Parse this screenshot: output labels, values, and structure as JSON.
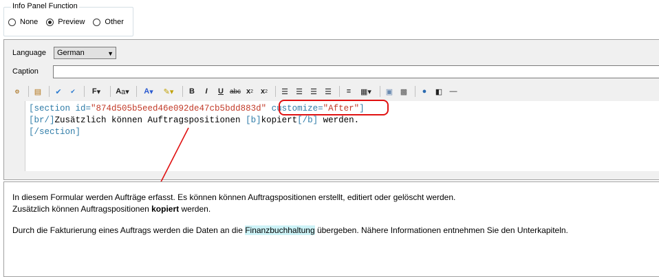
{
  "info_panel": {
    "title": "Info Panel Function",
    "options": [
      {
        "label": "None",
        "selected": false
      },
      {
        "label": "Preview",
        "selected": true
      },
      {
        "label": "Other",
        "selected": false
      }
    ]
  },
  "form": {
    "language_label": "Language",
    "language_value": "German",
    "caption_label": "Caption",
    "caption_value": ""
  },
  "toolbar": {
    "icons": [
      "section-icon",
      "document-icon",
      "spellcheck-icon",
      "spellcheck-all-icon",
      "font-icon",
      "font-size-icon",
      "font-color-icon",
      "highlight-color-icon",
      "bold-icon",
      "italic-icon",
      "underline-icon",
      "strikethrough-icon",
      "subscript-icon",
      "superscript-icon",
      "align-left-icon",
      "align-center-icon",
      "align-right-icon",
      "justify-icon",
      "list-icon",
      "table-icon",
      "image-icon",
      "photo-icon",
      "globe-link-icon",
      "insert-document-icon",
      "horizontal-rule-icon"
    ]
  },
  "editor": {
    "line1": {
      "open": "[section ",
      "attr_id": "id=",
      "id_value": "\"874d505b5eed46e092de47cb5bdd883d\"",
      "attr_customize": "customize=",
      "customize_value": "\"After\"",
      "close": "]"
    },
    "line2": {
      "br": "[br/]",
      "text1": "Zusätzlich können Auftragspositionen ",
      "b_open": "[b]",
      "bold_text": "kopiert",
      "b_close": "[/b]",
      "text2": " werden."
    },
    "line3": "[/section]"
  },
  "preview": {
    "p1": "In diesem Formular werden Aufträge erfasst. Es können können Auftragspositionen erstellt, editiert oder gelöscht werden.",
    "p2_text1": "Zusätzlich können Auftragspositionen ",
    "p2_bold": "kopiert",
    "p2_text2": " werden.",
    "p3_text1": "Durch die Fakturierung eines Auftrags werden die Daten an die ",
    "p3_highlight": "Finanzbuchhaltung",
    "p3_text2": " übergeben. Nähere Informationen entnehmen Sie den Unterkapiteln."
  },
  "colors": {
    "annotation": "#e01010",
    "tag": "#2f7ca8",
    "value": "#c23a28",
    "link_highlight": "#cdf3f7"
  }
}
